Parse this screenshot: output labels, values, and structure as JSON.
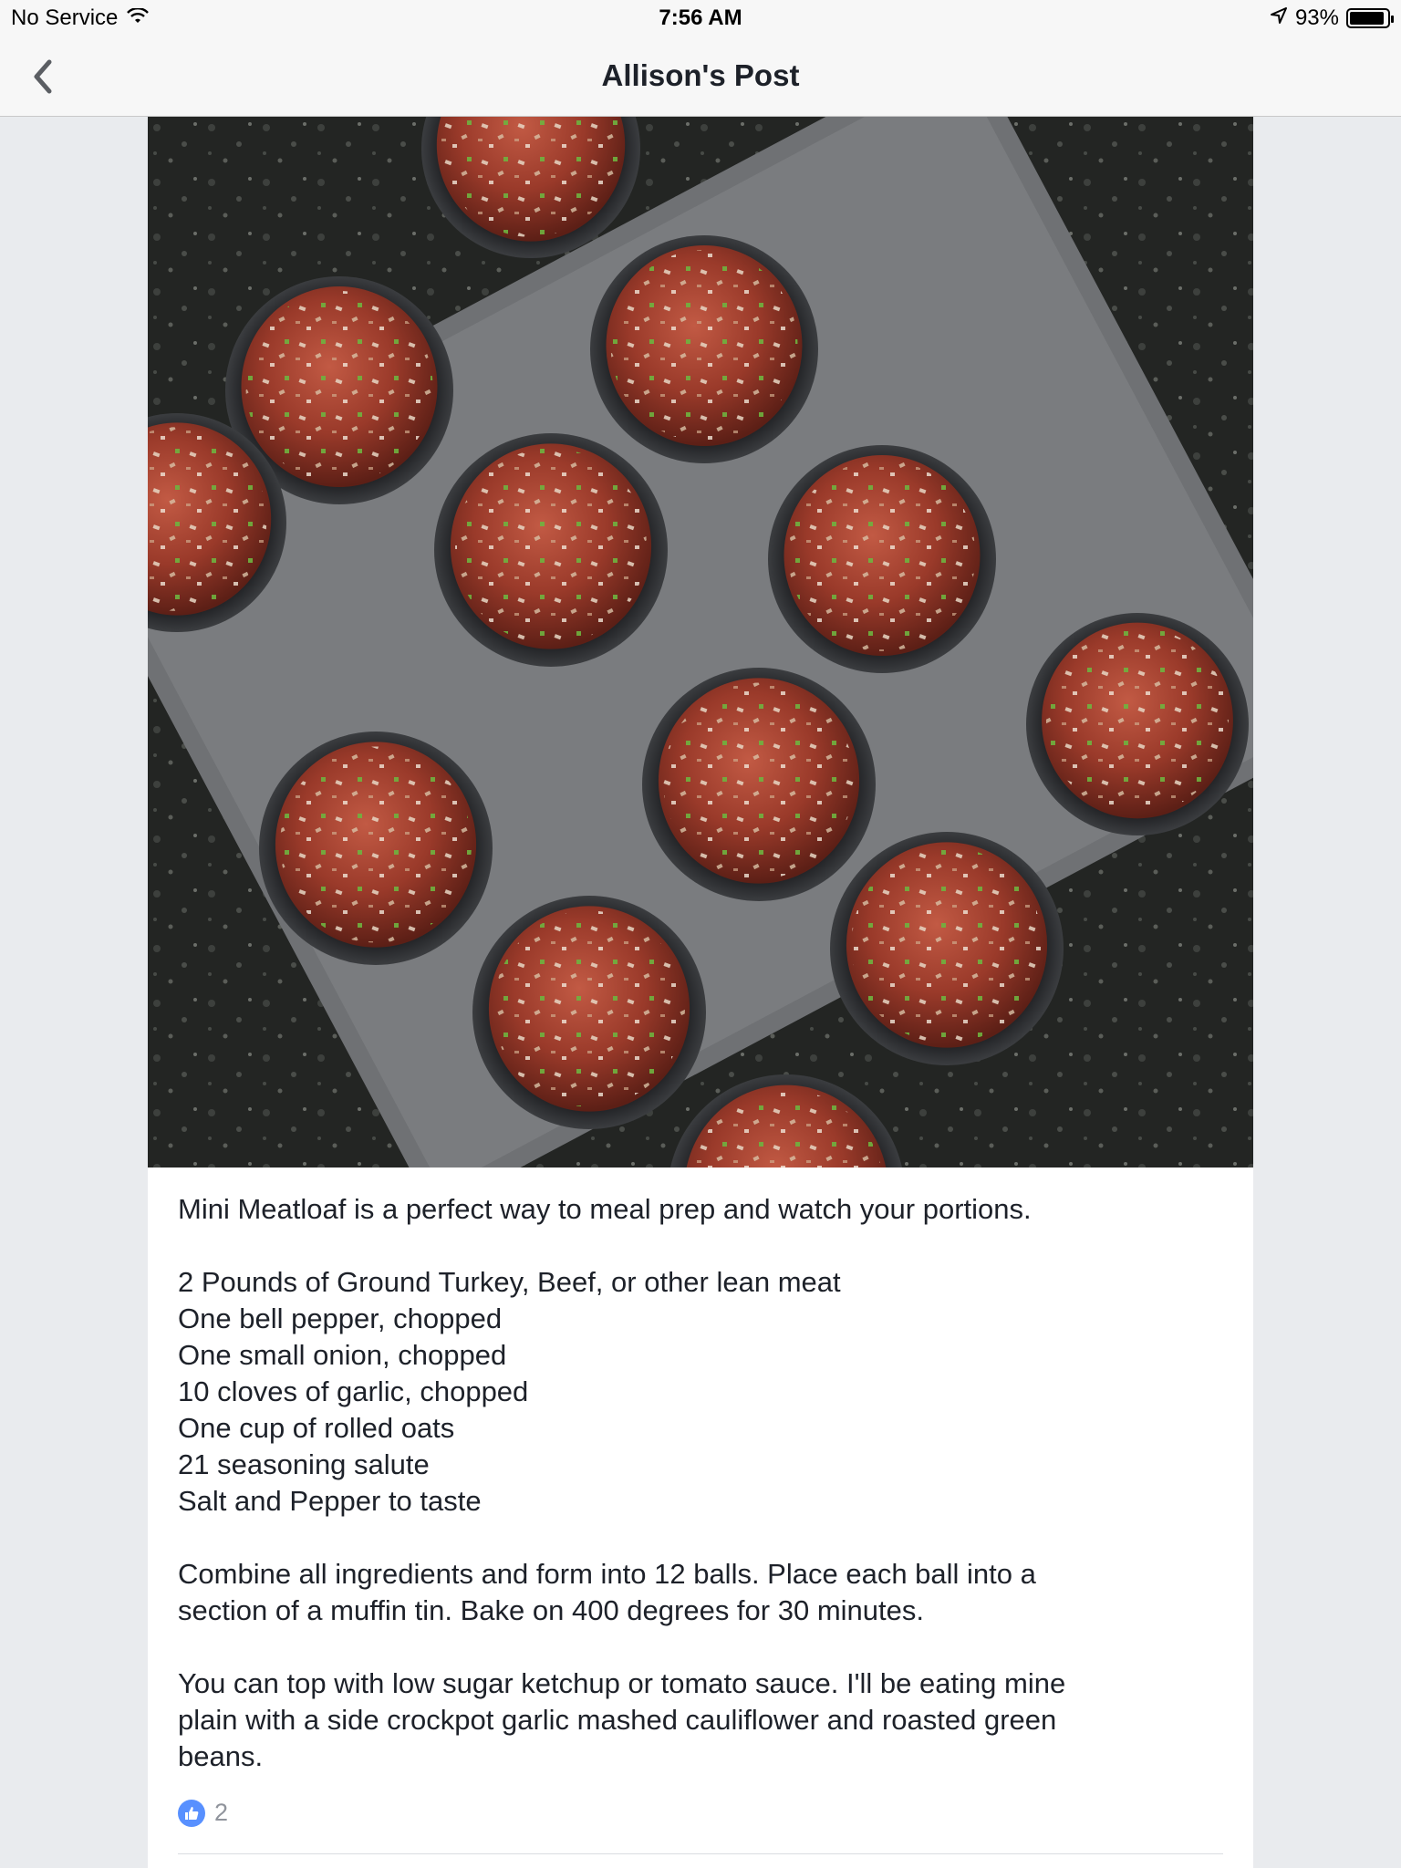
{
  "status": {
    "carrier": "No Service",
    "time": "7:56 AM",
    "battery": "93%",
    "battery_level": 0.93
  },
  "nav": {
    "title": "Allison's Post"
  },
  "post": {
    "intro": "Mini Meatloaf is a perfect way to meal prep and watch your portions.",
    "ingredients": [
      "2 Pounds of Ground Turkey, Beef, or other lean meat",
      "One bell pepper, chopped",
      "One small onion, chopped",
      "10 cloves of garlic, chopped",
      "One cup of rolled oats",
      "21 seasoning salute",
      "Salt and Pepper to taste"
    ],
    "instructions": [
      "Combine all ingredients and form into 12 balls. Place each ball into a",
      "section of a muffin tin. Bake on 400 degrees for 30 minutes."
    ],
    "notes": [
      "You can top with low sugar ketchup or tomato sauce. I'll be eating mine",
      "plain with a side crockpot garlic mashed cauliflower and roasted green",
      "beans."
    ],
    "like_count": "2"
  },
  "colors": {
    "like_blue": "#5890ff",
    "meat": "#9a3a2a",
    "tin": "#6f7174"
  }
}
